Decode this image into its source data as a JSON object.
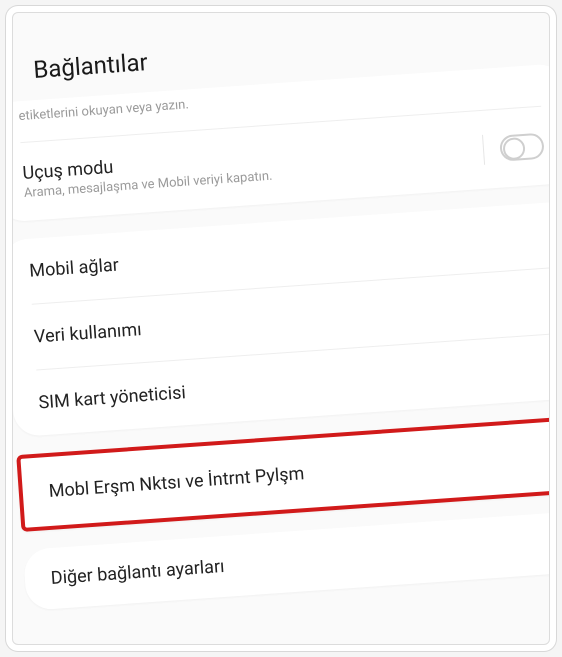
{
  "header": {
    "title": "Bağlantılar"
  },
  "truncated": {
    "text": "etiketlerini okuyan veya yazın."
  },
  "flight_mode": {
    "title": "Uçuş modu",
    "subtitle": "Arama, mesajlaşma ve Mobil veriyi kapatın.",
    "enabled": false
  },
  "network_group": {
    "mobile_networks": "Mobil ağlar",
    "data_usage": "Veri kullanımı",
    "sim_manager": "SIM kart yöneticisi"
  },
  "hotspot": {
    "label": "Mobl Erşm Nktsı ve İntrnt Pylşm"
  },
  "more": {
    "label": "Diğer bağlantı ayarları"
  },
  "colors": {
    "highlight": "#d11a1a"
  }
}
